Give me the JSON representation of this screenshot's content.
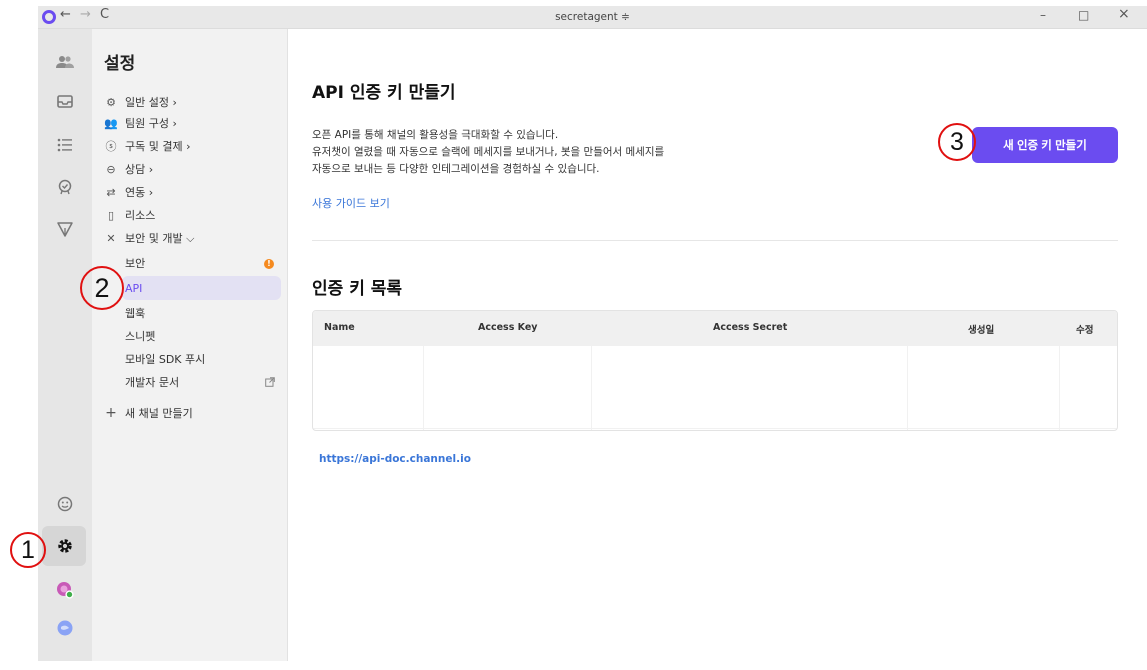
{
  "window": {
    "title": "secretagent ≑",
    "nav_back": "←",
    "nav_forward": "→",
    "nav_reload": "C",
    "minimize": "–",
    "maximize": "□",
    "close": "×"
  },
  "sidebar": {
    "title": "설정",
    "items": [
      {
        "icon": "gear-icon",
        "glyph": "⚙",
        "label": "일반 설정 ›"
      },
      {
        "icon": "team-icon",
        "glyph": "👥",
        "label": "팀원 구성 ›"
      },
      {
        "icon": "dollar-icon",
        "glyph": "ⓢ",
        "label": "구독 및 결제 ›"
      },
      {
        "icon": "chat-icon",
        "glyph": "⊖",
        "label": "상담 ›"
      },
      {
        "icon": "link-arrows-icon",
        "glyph": "⇄",
        "label": "연동 ›"
      },
      {
        "icon": "book-icon",
        "glyph": "▯",
        "label": "리소스"
      },
      {
        "icon": "tools-icon",
        "glyph": "✕",
        "label": "보안 및 개발 ⌵"
      }
    ],
    "sub_items": [
      "보안",
      "API",
      "웹훅",
      "스니펫",
      "모바일 SDK 푸시",
      "개발자 문서"
    ],
    "security_badge": "!",
    "new_channel": "새 채널 만들기",
    "new_channel_glyph": "+"
  },
  "main": {
    "title": "API 인증 키 만들기",
    "description_lines": [
      "오픈 API를 통해 채널의 활용성을 극대화할 수 있습니다.",
      "유저챗이 열렸을 때 자동으로 슬랙에 메세지를 보내거나, 봇을 만들어서 메세지를",
      "자동으로 보내는 등 다양한 인테그레이션을 경험하실 수 있습니다."
    ],
    "guide_link": "사용 가이드 보기",
    "create_button": "새 인증 키 만들기",
    "list_title": "인증 키 목록",
    "table": {
      "columns": [
        "Name",
        "Access Key",
        "Access Secret",
        "생성일",
        "수정"
      ],
      "rows": []
    },
    "doc_url": "https://api-doc.channel.io"
  },
  "annotations": [
    "1",
    "2",
    "3"
  ],
  "colors": {
    "accent": "#6b4cf0",
    "link": "#3a76d8",
    "warning": "#f58a1f",
    "annotation": "#e01010"
  }
}
